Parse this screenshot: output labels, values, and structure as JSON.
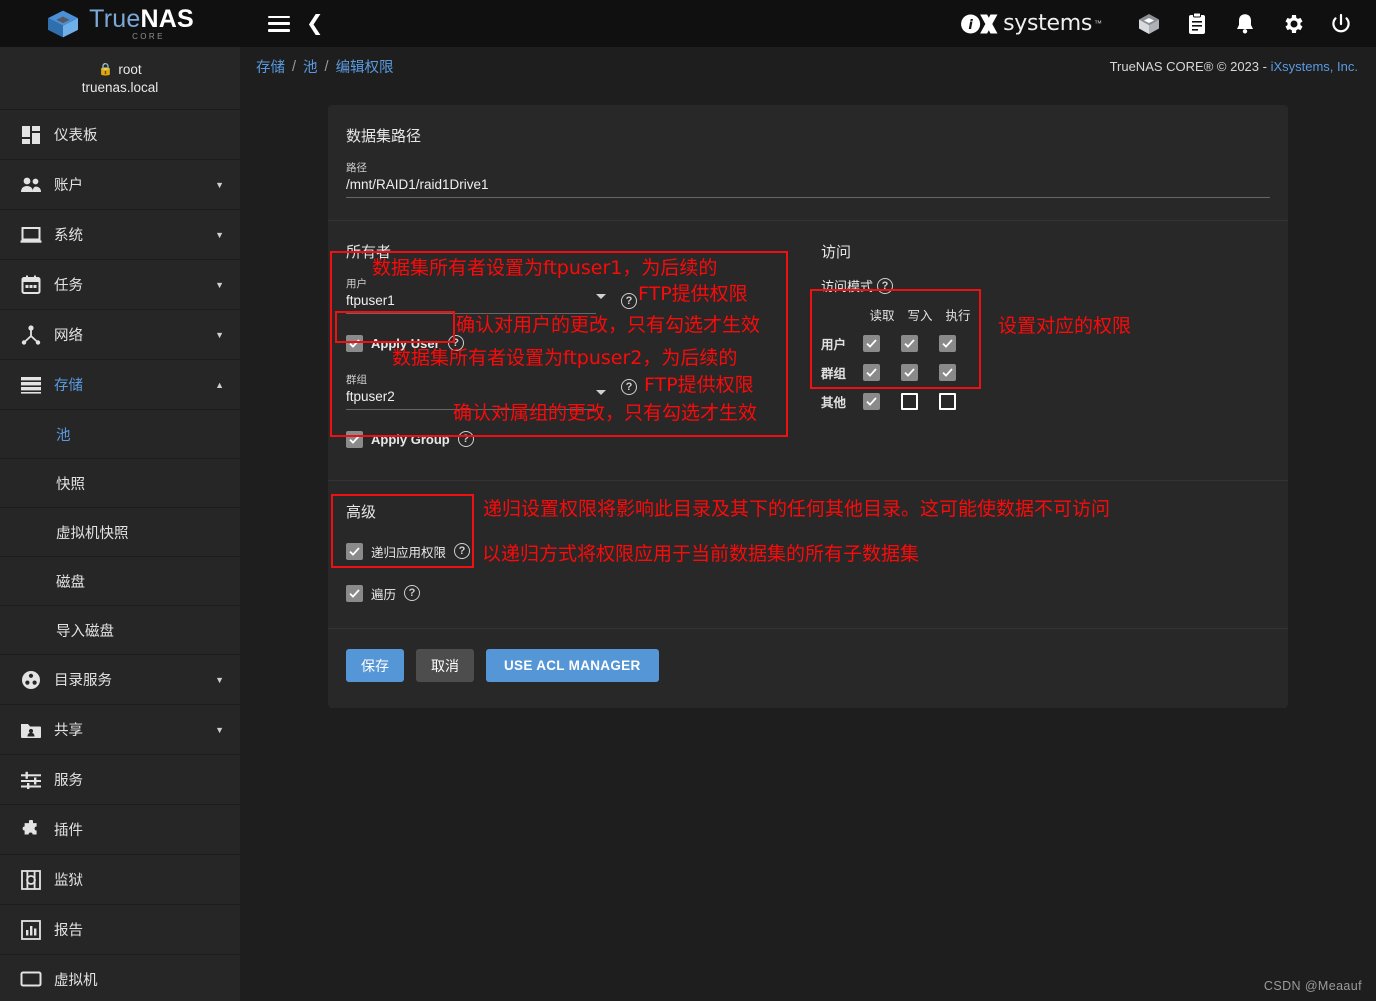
{
  "brand": {
    "name_part1": "True",
    "name_part2": "NAS",
    "sub": "CORE",
    "vendor_word": "systems",
    "vendor_tm": "™"
  },
  "topbar": {
    "menu_icon": "hamburger-icon",
    "collapse_icon": "chevron-left-icon",
    "icons": [
      {
        "name": "cube-icon",
        "glyph": "⬡"
      },
      {
        "name": "clipboard-icon",
        "glyph": "📋"
      },
      {
        "name": "bell-icon",
        "glyph": "🔔"
      },
      {
        "name": "gear-icon",
        "glyph": "⚙"
      },
      {
        "name": "power-icon",
        "glyph": "⏻"
      }
    ]
  },
  "sidebar": {
    "user": {
      "lock_icon": "lock-icon",
      "username": "root",
      "hostname": "truenas.local"
    },
    "items": [
      {
        "label": "仪表板",
        "icon": "dashboard-icon",
        "expandable": false,
        "active": false
      },
      {
        "label": "账户",
        "icon": "accounts-icon",
        "expandable": true,
        "active": false
      },
      {
        "label": "系统",
        "icon": "system-icon",
        "expandable": true,
        "active": false
      },
      {
        "label": "任务",
        "icon": "tasks-icon",
        "expandable": true,
        "active": false
      },
      {
        "label": "网络",
        "icon": "network-icon",
        "expandable": true,
        "active": false
      },
      {
        "label": "存储",
        "icon": "storage-icon",
        "expandable": true,
        "active": true,
        "expanded": true
      }
    ],
    "storage_children": [
      {
        "label": "池",
        "active": true
      },
      {
        "label": "快照",
        "active": false
      },
      {
        "label": "虚拟机快照",
        "active": false
      },
      {
        "label": "磁盘",
        "active": false
      },
      {
        "label": "导入磁盘",
        "active": false
      }
    ],
    "items_after": [
      {
        "label": "目录服务",
        "icon": "directory-services-icon",
        "expandable": true
      },
      {
        "label": "共享",
        "icon": "sharing-icon",
        "expandable": true
      },
      {
        "label": "服务",
        "icon": "services-icon",
        "expandable": false
      },
      {
        "label": "插件",
        "icon": "plugins-icon",
        "expandable": false
      },
      {
        "label": "监狱",
        "icon": "jails-icon",
        "expandable": false
      },
      {
        "label": "报告",
        "icon": "reporting-icon",
        "expandable": false
      },
      {
        "label": "虚拟机",
        "icon": "virtual-machines-icon",
        "expandable": false
      }
    ]
  },
  "breadcrumb": {
    "items": [
      "存储",
      "池",
      "编辑权限"
    ],
    "separator": "/"
  },
  "copyright": {
    "text": "TrueNAS CORE® © 2023 - ",
    "link": "iXsystems, Inc."
  },
  "form": {
    "dataset_path_section": {
      "title": "数据集路径",
      "path_label": "路径",
      "path_value": "/mnt/RAID1/raid1Drive1"
    },
    "owner_section": {
      "title": "所有者",
      "user_label": "用户",
      "user_value": "ftpuser1",
      "apply_user_label": "Apply User",
      "apply_user_checked": true,
      "group_label": "群组",
      "group_value": "ftpuser2",
      "apply_group_label": "Apply Group",
      "apply_group_checked": true,
      "help_icon": "help-icon"
    },
    "access_section": {
      "title": "访问",
      "mode_label": "访问模式",
      "columns": [
        "读取",
        "写入",
        "执行"
      ],
      "rows": [
        {
          "label": "用户",
          "values": [
            true,
            true,
            true
          ]
        },
        {
          "label": "群组",
          "values": [
            true,
            true,
            true
          ]
        },
        {
          "label": "其他",
          "values": [
            true,
            false,
            false
          ]
        }
      ]
    },
    "advanced_section": {
      "title": "高级",
      "recursive_label": "递归应用权限",
      "recursive_checked": true,
      "traverse_label": "遍历",
      "traverse_checked": true
    },
    "buttons": {
      "save": "保存",
      "cancel": "取消",
      "acl_manager": "USE ACL MANAGER"
    }
  },
  "annotations": [
    {
      "id": "a1",
      "text": "数据集所有者设置为ftpuser1，为后续的"
    },
    {
      "id": "a2",
      "text": "FTP提供权限"
    },
    {
      "id": "a3",
      "text": "确认对用户的更改，只有勾选才生效"
    },
    {
      "id": "a4",
      "text": "数据集所有者设置为ftpuser2，为后续的"
    },
    {
      "id": "a5",
      "text": "FTP提供权限"
    },
    {
      "id": "a6",
      "text": "确认对属组的更改，只有勾选才生效"
    },
    {
      "id": "a7",
      "text": "设置对应的权限"
    },
    {
      "id": "a8",
      "text": "递归设置权限将影响此目录及其下的任何其他目录。这可能使数据不可访问"
    },
    {
      "id": "a9",
      "text": "以递归方式将权限应用于当前数据集的所有子数据集"
    }
  ],
  "watermark": "CSDN @Meaauf",
  "colors": {
    "accent_blue": "#5596d6",
    "annotation_red": "#fb0a0a",
    "sidebar_bg": "#262626",
    "card_bg": "#282828",
    "page_bg": "#1e1e1e"
  }
}
